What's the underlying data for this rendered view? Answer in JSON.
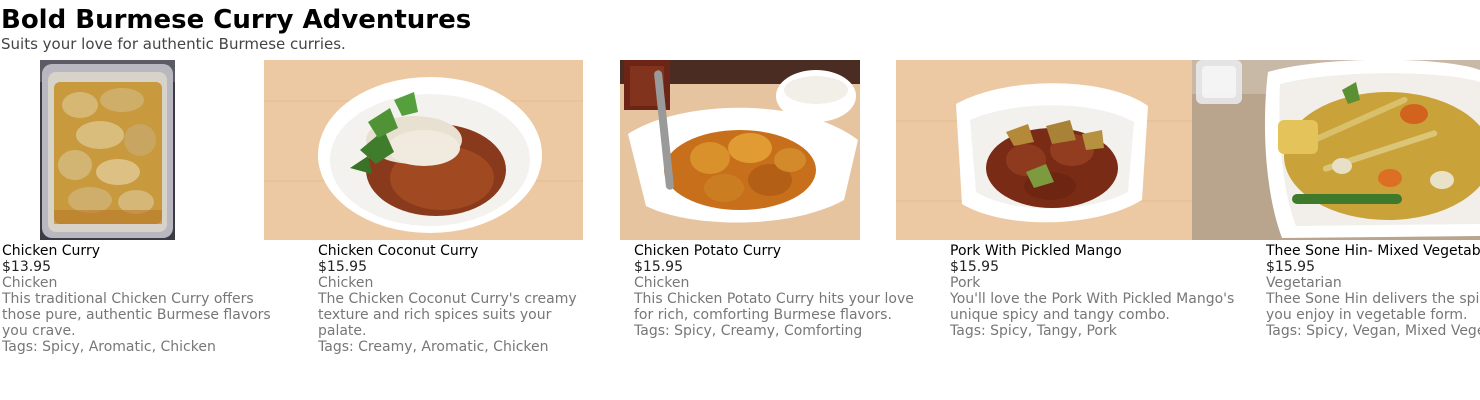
{
  "page": {
    "title": "Bold Burmese Curry Adventures",
    "subtitle": "Suits your love for authentic Burmese curries."
  },
  "colors": {
    "title": "#000000",
    "subtitle": "#444444",
    "muted_text": "#777777",
    "table_wood": "#ecc9a3"
  },
  "dishes": [
    {
      "name": "Chicken Curry",
      "price": "$13.95",
      "category": "Chicken",
      "description": "This traditional Chicken Curry offers those pure, authentic Burmese flavors you crave.",
      "tags": "Tags: Spicy, Aromatic, Chicken"
    },
    {
      "name": "Chicken Coconut Curry",
      "price": "$15.95",
      "category": "Chicken",
      "description": "The Chicken Coconut Curry's creamy texture and rich spices suits your palate.",
      "tags": "Tags: Creamy, Aromatic, Chicken"
    },
    {
      "name": "Chicken Potato Curry",
      "price": "$15.95",
      "category": "Chicken",
      "description": "This Chicken Potato Curry hits your love for rich, comforting Burmese flavors.",
      "tags": "Tags: Spicy, Creamy, Comforting"
    },
    {
      "name": "Pork With Pickled Mango",
      "price": "$15.95",
      "category": "Pork",
      "description": "You'll love the Pork With Pickled Mango's unique spicy and tangy combo.",
      "tags": "Tags: Spicy, Tangy, Pork"
    },
    {
      "name": "Thee Sone Hin- Mixed Vegetable Curry",
      "price": "$15.95",
      "category": "Vegetarian",
      "description": "Thee Sone Hin delivers the spicy flavors you enjoy in vegetable form.",
      "tags": "Tags: Spicy, Vegan, Mixed Vegetables"
    }
  ]
}
